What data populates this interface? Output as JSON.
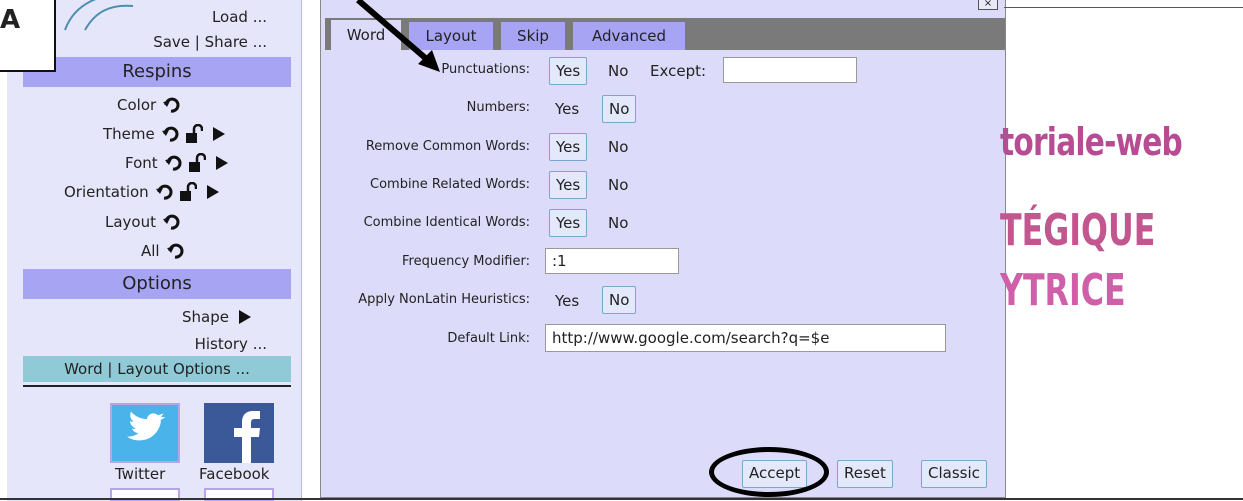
{
  "sidebar": {
    "load": "Load ...",
    "save_share": "Save | Share ...",
    "respins_header": "Respins",
    "respins": [
      {
        "label": "Color",
        "lock": false,
        "arrow": false
      },
      {
        "label": "Theme",
        "lock": true,
        "arrow": true
      },
      {
        "label": "Font",
        "lock": true,
        "arrow": true
      },
      {
        "label": "Orientation",
        "lock": true,
        "arrow": true
      },
      {
        "label": "Layout",
        "lock": false,
        "arrow": false
      },
      {
        "label": "All",
        "lock": false,
        "arrow": false
      }
    ],
    "options_header": "Options",
    "shape": "Shape",
    "history": "History ...",
    "word_layout_options": "Word | Layout Options ...",
    "social": [
      {
        "label": "Twitter",
        "color": "#4ab3e9",
        "icon": "twitter-bird-icon"
      },
      {
        "label": "Facebook",
        "color": "#3b5998",
        "icon": "facebook-f-icon"
      }
    ]
  },
  "overlay_label": "A",
  "dialog": {
    "tabs": [
      "Word",
      "Layout",
      "Skip",
      "Advanced"
    ],
    "active_tab": "Word",
    "rows": {
      "punctuations": {
        "label": "Punctuations:",
        "yes": "Yes",
        "no": "No",
        "selected": "Yes",
        "except_label": "Except:",
        "except_value": ""
      },
      "numbers": {
        "label": "Numbers:",
        "yes": "Yes",
        "no": "No",
        "selected": "No"
      },
      "remove_common": {
        "label": "Remove Common Words:",
        "yes": "Yes",
        "no": "No",
        "selected": "Yes"
      },
      "combine_related": {
        "label": "Combine Related Words:",
        "yes": "Yes",
        "no": "No",
        "selected": "Yes"
      },
      "combine_identical": {
        "label": "Combine Identical Words:",
        "yes": "Yes",
        "no": "No",
        "selected": "Yes"
      },
      "frequency": {
        "label": "Frequency Modifier:",
        "value": ":1"
      },
      "nonlatin": {
        "label": "Apply NonLatin Heuristics:",
        "yes": "Yes",
        "no": "No",
        "selected": "No"
      },
      "default_link": {
        "label": "Default Link:",
        "value": "http://www.google.com/search?q=$e"
      }
    },
    "buttons": {
      "accept": "Accept",
      "reset": "Reset",
      "classic": "Classic"
    }
  },
  "background": {
    "line1": "toriale-web",
    "line2": "TÉGIQUE",
    "line3": "YTRICE"
  },
  "colors": {
    "sidebar_bg": "#e6e6fa",
    "header_bar": "#a8a4f4",
    "selected_item": "#8fcad6",
    "dialog_bg": "#dcdcfa",
    "tab_strip": "#7a7a7a",
    "accent_magenta": "#b74c92"
  }
}
